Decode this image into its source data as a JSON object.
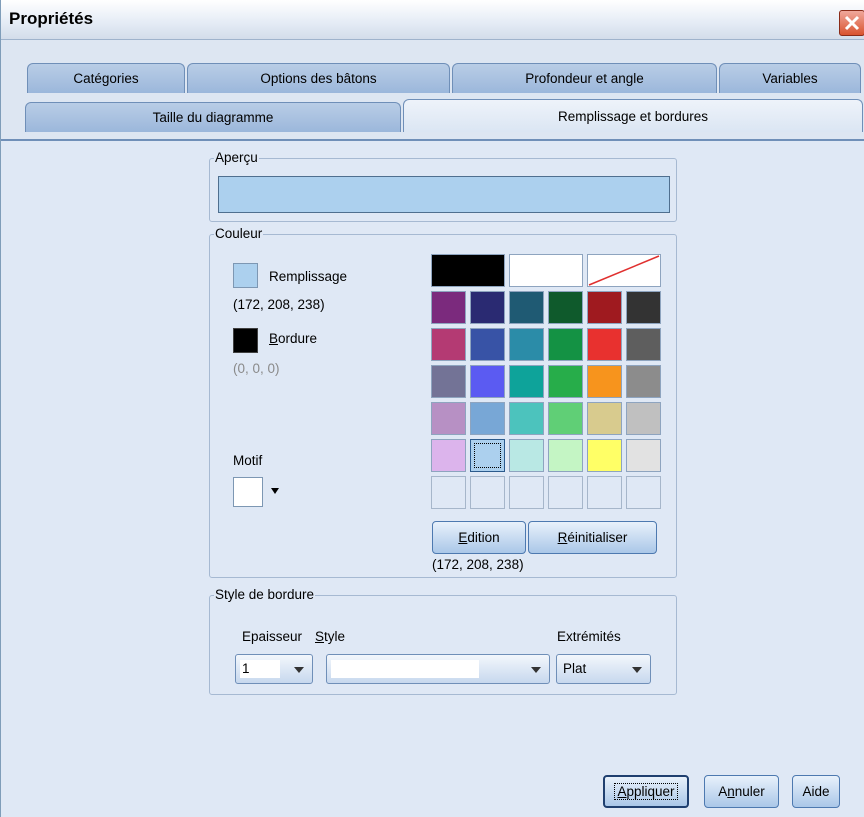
{
  "window": {
    "title": "Propriétés"
  },
  "tabs": {
    "row1": [
      "Catégories",
      "Options des bâtons",
      "Profondeur et angle",
      "Variables"
    ],
    "row2": [
      "Taille du diagramme",
      "Remplissage et bordures"
    ]
  },
  "preview": {
    "legend": "Aperçu",
    "fill": "#acd0ee"
  },
  "color": {
    "legend": "Couleur",
    "fill_label": "Remplissage",
    "fill_value": "(172, 208, 238)",
    "fill_color": "#acd0ee",
    "border_label": "Bordure",
    "border_value": "(0, 0, 0)",
    "border_color": "#000000",
    "pattern_label": "Motif",
    "palette_rows": [
      [
        "#7b2a7d",
        "#2a2a72",
        "#1f5a73",
        "#0f5a2c",
        "#9f1a1f",
        "#333333"
      ],
      [
        "#b43a73",
        "#3853a6",
        "#2b8ca8",
        "#149244",
        "#e8312f",
        "#5e5e5e"
      ],
      [
        "#737396",
        "#5b5bf2",
        "#0ea39a",
        "#27ad4a",
        "#f7941d",
        "#8c8c8c"
      ],
      [
        "#b790c4",
        "#78a7d6",
        "#4cc3bd",
        "#60cf76",
        "#d8cb8e",
        "#c0c0c0"
      ],
      [
        "#dcb4ec",
        "#acd0ee",
        "#b9e8e4",
        "#c4f5c4",
        "#ffff66",
        "#e2e2e2"
      ]
    ],
    "edit_button": "Edition",
    "reset_button": "Réinitialiser",
    "selected_value": "(172, 208, 238)"
  },
  "border_style": {
    "legend": "Style de bordure",
    "thickness_label": "Epaisseur",
    "style_label": "Style",
    "ends_label": "Extrémités",
    "thickness_value": "1",
    "ends_value": "Plat"
  },
  "footer": {
    "apply": "Appliquer",
    "cancel": "Annuler",
    "help": "Aide"
  }
}
